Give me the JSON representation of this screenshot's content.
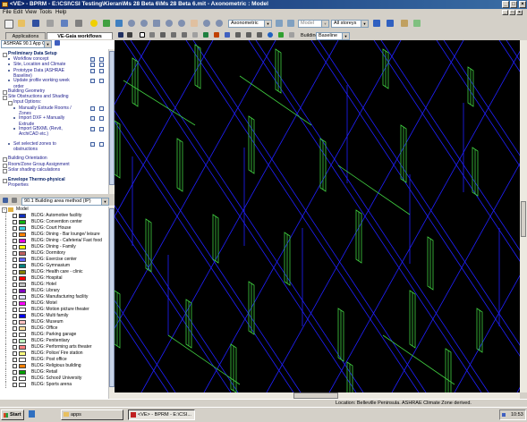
{
  "window": {
    "title": "<VE> - BPRM - E:\\CSI\\CSI Testing\\Kieran\\Ms 28 Beta 6\\Ms 28 Beta 6.mit - Axonometric : Model",
    "minimize_glyph": "_",
    "maximize_glyph": "□",
    "close_glyph": "×"
  },
  "menu": [
    "File",
    "Edit",
    "View",
    "Tools",
    "Help"
  ],
  "toolbar": {
    "view_combo": "Axonometric",
    "model_combo": "Model",
    "storeys_combo": "All storeys"
  },
  "left_panel": {
    "tabs": [
      "Applications",
      "VE-Gaia workflows"
    ],
    "workflow_combo": "ASHRAE 90.1 App G",
    "tasks": [
      {
        "label": "Preliminary Data Setup",
        "level": 0,
        "type": "section",
        "expander": "−"
      },
      {
        "label": "Workflow concept",
        "level": 1,
        "type": "item"
      },
      {
        "label": "Site, Location and Climate",
        "level": 1,
        "type": "item"
      },
      {
        "label": "Prototype Data (ASHRAE",
        "level": 1,
        "type": "item"
      },
      {
        "label": "Baseline)",
        "level": 1,
        "type": "cont"
      },
      {
        "label": "Update profile working week",
        "level": 1,
        "type": "item"
      },
      {
        "label": "order",
        "level": 1,
        "type": "cont"
      },
      {
        "label": "Building Geometry",
        "level": 0,
        "type": "group",
        "expander": "+"
      },
      {
        "label": "Site Obstructions and Shading",
        "level": 0,
        "type": "group",
        "expander": "−"
      },
      {
        "label": "Input Options:",
        "level": 1,
        "type": "group",
        "expander": "−"
      },
      {
        "label": "Manually Extrude Rooms /",
        "level": 2,
        "type": "item"
      },
      {
        "label": "Zones",
        "level": 2,
        "type": "cont"
      },
      {
        "label": "Import DXF + Manually",
        "level": 2,
        "type": "item"
      },
      {
        "label": "Extrude",
        "level": 2,
        "type": "cont"
      },
      {
        "label": "Import GBXML (Revit,",
        "level": 2,
        "type": "item"
      },
      {
        "label": "ArchiCAD etc.)",
        "level": 2,
        "type": "cont"
      },
      {
        "label": "",
        "level": 2,
        "type": "spacer"
      },
      {
        "label": "Set selected zones to",
        "level": 1,
        "type": "item"
      },
      {
        "label": "obstructions",
        "level": 1,
        "type": "cont"
      },
      {
        "label": "",
        "level": 0,
        "type": "spacer"
      },
      {
        "label": "Building Orientation",
        "level": 0,
        "type": "group",
        "expander": "+"
      },
      {
        "label": "Room/Zone Group Assignment",
        "level": 0,
        "type": "group",
        "expander": "+"
      },
      {
        "label": "Solar shading calculations",
        "level": 0,
        "type": "group",
        "expander": "+"
      },
      {
        "label": "",
        "level": 0,
        "type": "spacer"
      },
      {
        "label": "Envelope Thermo-physical",
        "level": 0,
        "type": "section",
        "expander": "+"
      },
      {
        "label": "Properties",
        "level": 0,
        "type": "cont"
      }
    ],
    "grouping_combo": "90.1 Building area method (IP)",
    "tree_root": "Model",
    "groups": [
      {
        "label": "BLDG: Automotive facility",
        "color": "#1030c0"
      },
      {
        "label": "BLDG: Convention center",
        "color": "#10b010"
      },
      {
        "label": "BLDG: Court House",
        "color": "#40d0e0"
      },
      {
        "label": "BLDG: Dining - Bar lounge/ leisure",
        "color": "#ff8000"
      },
      {
        "label": "BLDG: Dining - Cafeteria/ Fast food",
        "color": "#e000e0"
      },
      {
        "label": "BLDG: Dining - Family",
        "color": "#ffff00"
      },
      {
        "label": "BLDG: Dormitory",
        "color": "#c06060"
      },
      {
        "label": "BLDG: Exercise center",
        "color": "#6060ff"
      },
      {
        "label": "BLDG: Gymnasium",
        "color": "#008080"
      },
      {
        "label": "BLDG: Health care - clinic",
        "color": "#808000"
      },
      {
        "label": "BLDG: Hospital",
        "color": "#ff0000"
      },
      {
        "label": "BLDG: Hotel",
        "color": "#c0c0c0"
      },
      {
        "label": "BLDG: Library",
        "color": "#8000c0"
      },
      {
        "label": "BLDG: Manufacturing facility",
        "color": "#e0e0ff"
      },
      {
        "label": "BLDG: Motel",
        "color": "#ff00ff"
      },
      {
        "label": "BLDG: Motion picture theater",
        "color": "#ffffff"
      },
      {
        "label": "BLDG: Multi family",
        "color": "#0000ff"
      },
      {
        "label": "BLDG: Museum",
        "color": "#ffc0c0"
      },
      {
        "label": "BLDG: Office",
        "color": "#ffe0a0"
      },
      {
        "label": "BLDG: Parking garage",
        "color": "#ffffff"
      },
      {
        "label": "BLDG: Penitentiary",
        "color": "#c0ffc0"
      },
      {
        "label": "BLDG: Performing arts theater",
        "color": "#ff8080"
      },
      {
        "label": "BLDG: Police/ Fire station",
        "color": "#ffff80"
      },
      {
        "label": "BLDG: Post office",
        "color": "#ffffff"
      },
      {
        "label": "BLDG: Religious building",
        "color": "#ff8000"
      },
      {
        "label": "BLDG: Retail",
        "color": "#00a000"
      },
      {
        "label": "BLDG: School/ University",
        "color": "#ffffff"
      },
      {
        "label": "BLDG: Sports arena",
        "color": "#ffffff"
      }
    ]
  },
  "view_toolbar": {
    "building_label": "Building",
    "building_combo": "Baseline"
  },
  "viewport": {
    "background": "#000000",
    "zone_outline_color": "#2020ff",
    "window_color": "#40d040"
  },
  "status": {
    "text": "Location: Belleville Peninsula. ASHRAE Climate Zone derived."
  },
  "taskbar": {
    "start": "Start",
    "tasks": [
      "apps",
      "<VE> - BPRM - E:\\CSI..."
    ],
    "clock": "10:53"
  }
}
